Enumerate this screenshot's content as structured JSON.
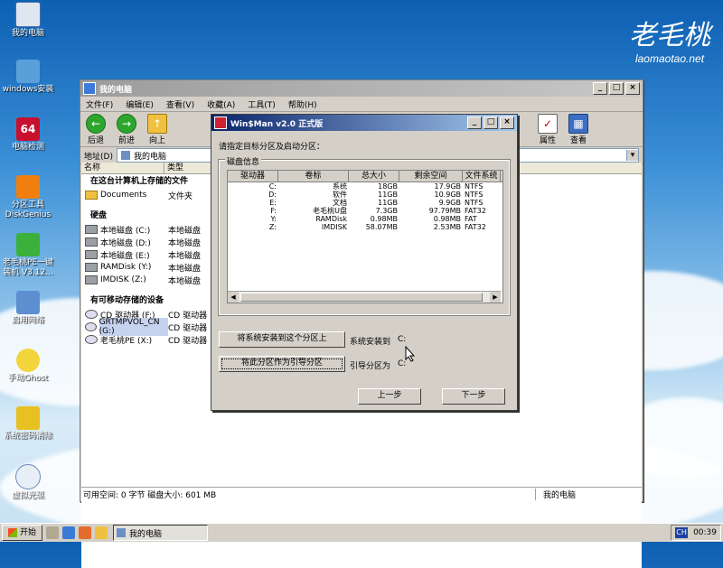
{
  "brand": {
    "logo_cn": "老毛桃",
    "url": "laomaotao.net"
  },
  "desktop_icons": [
    {
      "label": "我的电脑"
    },
    {
      "label": "windows安装"
    },
    {
      "label": "电脑检测"
    },
    {
      "label": "分区工具\nDiskGenius"
    },
    {
      "label": "老毛桃PE一键\n装机 V3.12..."
    },
    {
      "label": "启用网络"
    },
    {
      "label": "手动Ghost"
    },
    {
      "label": "系统密码清除"
    },
    {
      "label": "虚拟光驱"
    }
  ],
  "explorer": {
    "title": "我的电脑",
    "menu": [
      "文件(F)",
      "编辑(E)",
      "查看(V)",
      "收藏(A)",
      "工具(T)",
      "帮助(H)"
    ],
    "toolbar": {
      "back": "后退",
      "forward": "前进",
      "up": "向上",
      "properties": "属性",
      "view": "查看"
    },
    "address_label": "地址(D)",
    "address_value": "我的电脑",
    "columns": {
      "name": "名称",
      "type": "类型"
    },
    "group_docs": "在这台计算机上存储的文件",
    "documents": {
      "name": "Documents",
      "type": "文件夹"
    },
    "group_hdd": "硬盘",
    "hdd": [
      {
        "name": "本地磁盘 (C:)",
        "type": "本地磁盘"
      },
      {
        "name": "本地磁盘 (D:)",
        "type": "本地磁盘"
      },
      {
        "name": "本地磁盘 (E:)",
        "type": "本地磁盘"
      },
      {
        "name": "RAMDisk (Y:)",
        "type": "本地磁盘"
      },
      {
        "name": "IMDISK (Z:)",
        "type": "本地磁盘"
      }
    ],
    "group_removable": "有可移动存储的设备",
    "removable": [
      {
        "name": "CD 驱动器 (F:)",
        "type": "CD 驱动器"
      },
      {
        "name": "GRTMPVOL_CN (G:)",
        "type": "CD 驱动器"
      },
      {
        "name": "老毛桃PE (X:)",
        "type": "CD 驱动器"
      }
    ],
    "status_left": "可用空间: 0 字节  磁盘大小: 601 MB",
    "status_right": "我的电脑"
  },
  "dialog": {
    "title": "Win$Man v2.0 正式版",
    "prompt": "请指定目标分区及启动分区：",
    "group_label": "磁盘信息",
    "columns": [
      "驱动器",
      "卷标",
      "总大小",
      "剩余空间",
      "文件系统"
    ],
    "rows": [
      [
        "C:",
        "系统",
        "18GB",
        "17.9GB",
        "NTFS"
      ],
      [
        "D:",
        "软件",
        "11GB",
        "10.9GB",
        "NTFS"
      ],
      [
        "E:",
        "文档",
        "11GB",
        "9.9GB",
        "NTFS"
      ],
      [
        "F:",
        "老毛桃U盘",
        "7.3GB",
        "97.79MB",
        "FAT32"
      ],
      [
        "Y:",
        "RAMDisk",
        "0.98MB",
        "0.98MB",
        "FAT"
      ],
      [
        "Z:",
        "IMDISK",
        "58.07MB",
        "2.53MB",
        "FAT32"
      ]
    ],
    "btn_install": "将系统安装到这个分区上",
    "install_label": "系统安装到",
    "install_value": "C:",
    "btn_boot": "将此分区作为引导分区",
    "boot_label": "引导分区为",
    "boot_value": "C:",
    "btn_prev": "上一步",
    "btn_next": "下一步"
  },
  "taskbar": {
    "start": "开始",
    "task": "我的电脑",
    "lang": "CH",
    "time": "00:39"
  }
}
